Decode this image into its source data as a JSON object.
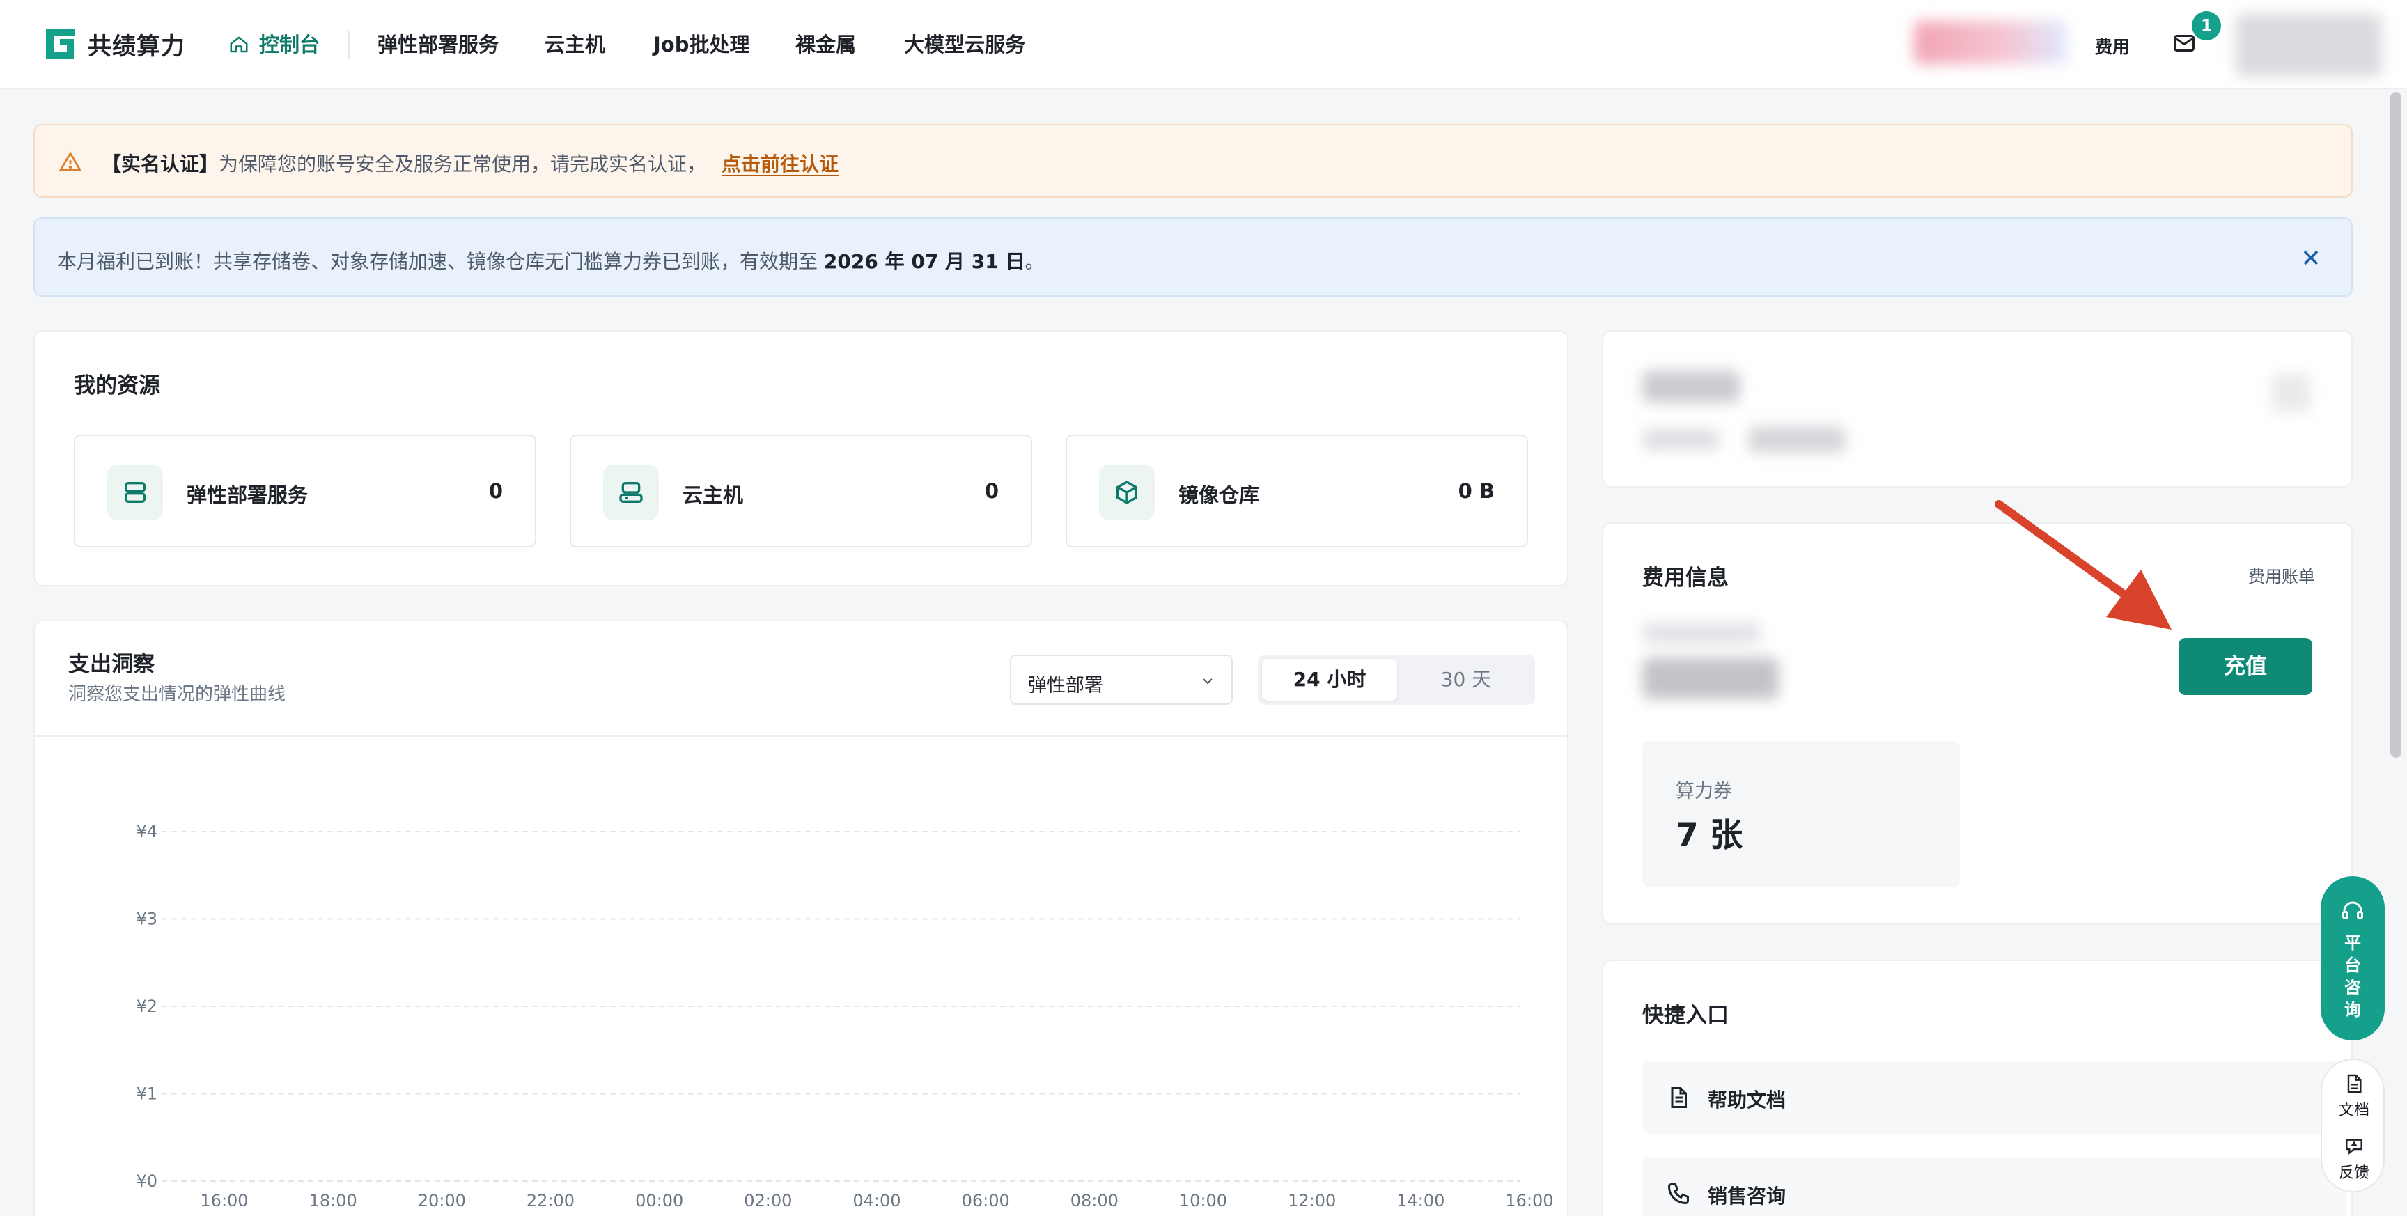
{
  "brand": {
    "name": "共绩算力",
    "color": "#0e8a76"
  },
  "nav": {
    "active": "控制台",
    "items": [
      "弹性部署服务",
      "云主机",
      "Job批处理",
      "裸金属",
      "大模型云服务"
    ],
    "fee": "费用",
    "mail_badge": "1"
  },
  "banners": {
    "verify_title": "【实名认证】",
    "verify_text": "为保障您的账号安全及服务正常使用，请完成实名认证，",
    "verify_link": "点击前往认证",
    "benefit_text": "本月福利已到账！共享存储卷、对象存储加速、镜像仓库无门槛算力券已到账，有效期至 ",
    "benefit_date": "2026 年 07 月 31 日",
    "benefit_end": "。"
  },
  "resources": {
    "title": "我的资源",
    "items": [
      {
        "label": "弹性部署服务",
        "value": "0",
        "icon": "server-icon"
      },
      {
        "label": "云主机",
        "value": "0",
        "icon": "host-icon"
      },
      {
        "label": "镜像仓库",
        "value": "0 B",
        "icon": "box-icon"
      }
    ]
  },
  "spending": {
    "title": "支出洞察",
    "subtitle": "洞察您支出情况的弹性曲线",
    "select_value": "弹性部署",
    "ranges": [
      "24 小时",
      "30 天"
    ],
    "active_range": "24 小时"
  },
  "chart_data": {
    "type": "line",
    "title": "",
    "xlabel": "",
    "ylabel": "",
    "x": [
      "16:00",
      "18:00",
      "20:00",
      "22:00",
      "00:00",
      "02:00",
      "04:00",
      "06:00",
      "08:00",
      "10:00",
      "12:00",
      "14:00",
      "16:00"
    ],
    "yticks": [
      "¥4",
      "¥3",
      "¥2",
      "¥1",
      "¥0"
    ],
    "ytick_values": [
      4,
      3,
      2,
      1,
      0
    ],
    "ylim": [
      0,
      4
    ],
    "grid": true,
    "series": []
  },
  "fee": {
    "title": "费用信息",
    "bill_link": "费用账单",
    "recharge": "充值",
    "coupon_label": "算力券",
    "coupon_value": "7 张"
  },
  "quick": {
    "title": "快捷入口",
    "items": [
      {
        "label": "帮助文档",
        "icon": "document-icon"
      },
      {
        "label": "销售咨询",
        "icon": "phone-icon"
      }
    ]
  },
  "float": {
    "consult": "平台咨询",
    "docs": "文档",
    "feedback": "反馈"
  },
  "colors": {
    "accent": "#14a08a",
    "warn_bg": "#fdf4ec",
    "info_bg": "#e9f2fc",
    "arrow": "#d9432c"
  }
}
